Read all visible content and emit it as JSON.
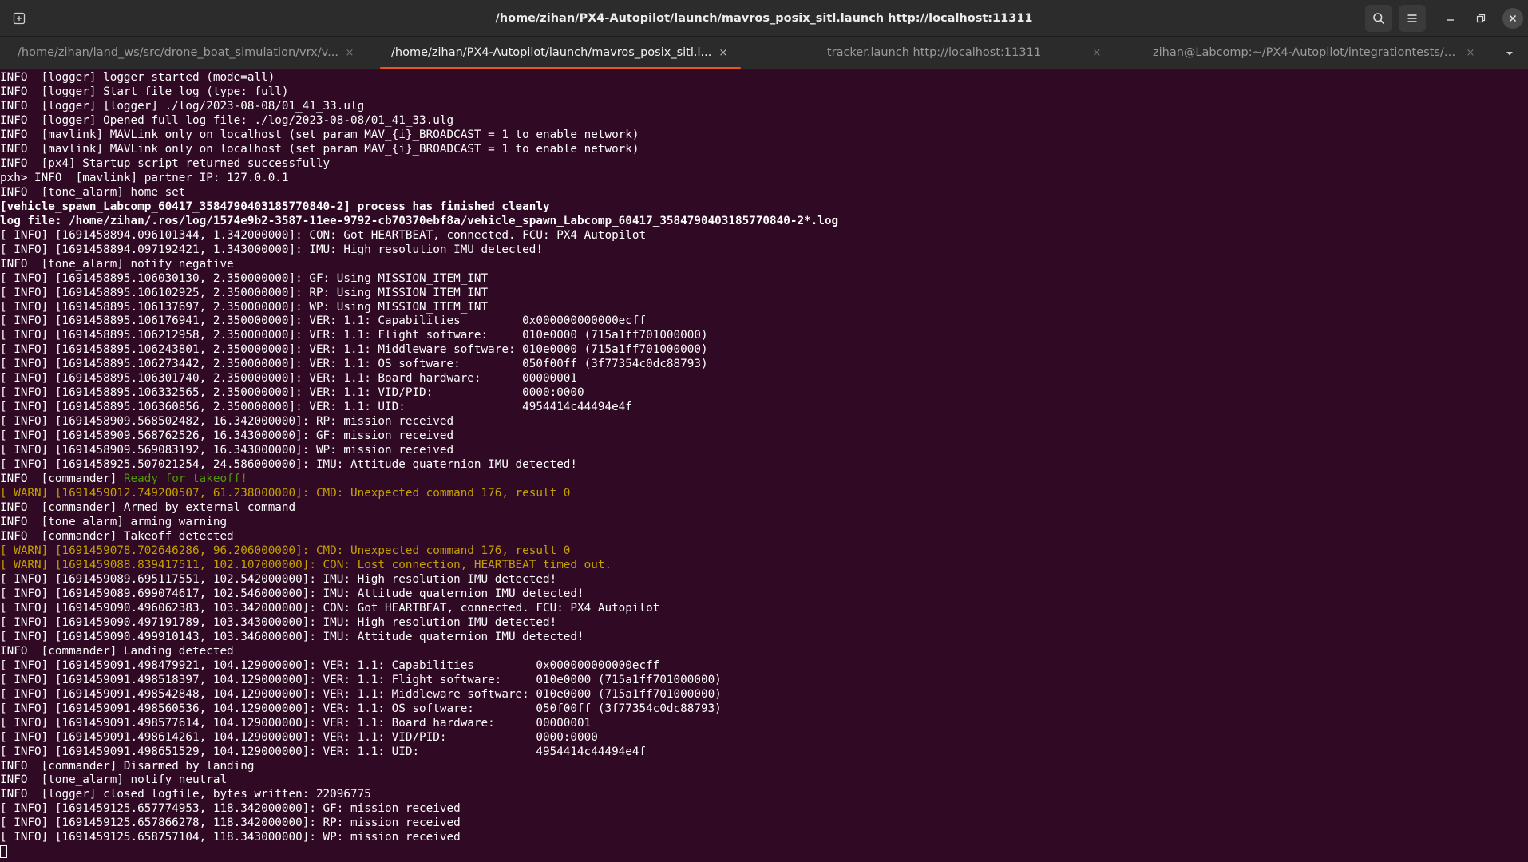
{
  "window": {
    "title": "/home/zihan/PX4-Autopilot/launch/mavros_posix_sitl.launch http://localhost:11311",
    "icons": {
      "new_tab": "new-tab-icon",
      "search": "search-icon",
      "menu": "hamburger-menu-icon",
      "minimize": "minimize-icon",
      "maximize": "maximize-icon",
      "close": "close-icon"
    },
    "accent_color": "#e95420",
    "background_color": "#300a24"
  },
  "tabs": [
    {
      "label": "/home/zihan/land_ws/src/drone_boat_simulation/vrx/v...",
      "active": false
    },
    {
      "label": "/home/zihan/PX4-Autopilot/launch/mavros_posix_sitl.l...",
      "active": true
    },
    {
      "label": "tracker.launch http://localhost:11311",
      "active": false
    },
    {
      "label": "zihan@Labcomp:~/PX4-Autopilot/integrationtests/pyt...",
      "active": false
    }
  ],
  "tab_close_glyph": "×",
  "terminal": {
    "colors": {
      "text": "#ffffff",
      "warn": "#c4a000",
      "ok": "#4e9a06"
    },
    "lines": [
      {
        "text": "INFO  [logger] logger started (mode=all)"
      },
      {
        "text": "INFO  [logger] Start file log (type: full)"
      },
      {
        "text": "INFO  [logger] [logger] ./log/2023-08-08/01_41_33.ulg"
      },
      {
        "text": "INFO  [logger] Opened full log file: ./log/2023-08-08/01_41_33.ulg"
      },
      {
        "text": "INFO  [mavlink] MAVLink only on localhost (set param MAV_{i}_BROADCAST = 1 to enable network)"
      },
      {
        "text": "INFO  [mavlink] MAVLink only on localhost (set param MAV_{i}_BROADCAST = 1 to enable network)"
      },
      {
        "text": "INFO  [px4] Startup script returned successfully"
      },
      {
        "text": "pxh> INFO  [mavlink] partner IP: 127.0.0.1"
      },
      {
        "text": "INFO  [tone_alarm] home set"
      },
      {
        "text": "[vehicle_spawn_Labcomp_60417_3584790403185770840-2] process has finished cleanly",
        "style": "bold"
      },
      {
        "text": "log file: /home/zihan/.ros/log/1574e9b2-3587-11ee-9792-cb70370ebf8a/vehicle_spawn_Labcomp_60417_3584790403185770840-2*.log",
        "style": "bold"
      },
      {
        "text": "[ INFO] [1691458894.096101344, 1.342000000]: CON: Got HEARTBEAT, connected. FCU: PX4 Autopilot"
      },
      {
        "text": "[ INFO] [1691458894.097192421, 1.343000000]: IMU: High resolution IMU detected!"
      },
      {
        "text": "INFO  [tone_alarm] notify negative"
      },
      {
        "text": "[ INFO] [1691458895.106030130, 2.350000000]: GF: Using MISSION_ITEM_INT"
      },
      {
        "text": "[ INFO] [1691458895.106102925, 2.350000000]: RP: Using MISSION_ITEM_INT"
      },
      {
        "text": "[ INFO] [1691458895.106137697, 2.350000000]: WP: Using MISSION_ITEM_INT"
      },
      {
        "text": "[ INFO] [1691458895.106176941, 2.350000000]: VER: 1.1: Capabilities         0x000000000000ecff"
      },
      {
        "text": "[ INFO] [1691458895.106212958, 2.350000000]: VER: 1.1: Flight software:     010e0000 (715a1ff701000000)"
      },
      {
        "text": "[ INFO] [1691458895.106243801, 2.350000000]: VER: 1.1: Middleware software: 010e0000 (715a1ff701000000)"
      },
      {
        "text": "[ INFO] [1691458895.106273442, 2.350000000]: VER: 1.1: OS software:         050f00ff (3f77354c0dc88793)"
      },
      {
        "text": "[ INFO] [1691458895.106301740, 2.350000000]: VER: 1.1: Board hardware:      00000001"
      },
      {
        "text": "[ INFO] [1691458895.106332565, 2.350000000]: VER: 1.1: VID/PID:             0000:0000"
      },
      {
        "text": "[ INFO] [1691458895.106360856, 2.350000000]: VER: 1.1: UID:                 4954414c44494e4f"
      },
      {
        "text": "[ INFO] [1691458909.568502482, 16.342000000]: RP: mission received"
      },
      {
        "text": "[ INFO] [1691458909.568762526, 16.343000000]: GF: mission received"
      },
      {
        "text": "[ INFO] [1691458909.569083192, 16.343000000]: WP: mission received"
      },
      {
        "text": "[ INFO] [1691458925.507021254, 24.586000000]: IMU: Attitude quaternion IMU detected!"
      },
      {
        "text": "INFO  [commander] ",
        "highlight": "Ready for takeoff!"
      },
      {
        "text": "[ WARN] [1691459012.749200507, 61.238000000]: CMD: Unexpected command 176, result 0",
        "style": "warn"
      },
      {
        "text": "INFO  [commander] Armed by external command"
      },
      {
        "text": "INFO  [tone_alarm] arming warning"
      },
      {
        "text": "INFO  [commander] Takeoff detected"
      },
      {
        "text": "[ WARN] [1691459078.702646286, 96.206000000]: CMD: Unexpected command 176, result 0",
        "style": "warn"
      },
      {
        "text": "[ WARN] [1691459088.839417511, 102.107000000]: CON: Lost connection, HEARTBEAT timed out.",
        "style": "warn"
      },
      {
        "text": "[ INFO] [1691459089.695117551, 102.542000000]: IMU: High resolution IMU detected!"
      },
      {
        "text": "[ INFO] [1691459089.699074617, 102.546000000]: IMU: Attitude quaternion IMU detected!"
      },
      {
        "text": "[ INFO] [1691459090.496062383, 103.342000000]: CON: Got HEARTBEAT, connected. FCU: PX4 Autopilot"
      },
      {
        "text": "[ INFO] [1691459090.497191789, 103.343000000]: IMU: High resolution IMU detected!"
      },
      {
        "text": "[ INFO] [1691459090.499910143, 103.346000000]: IMU: Attitude quaternion IMU detected!"
      },
      {
        "text": "INFO  [commander] Landing detected"
      },
      {
        "text": "[ INFO] [1691459091.498479921, 104.129000000]: VER: 1.1: Capabilities         0x000000000000ecff"
      },
      {
        "text": "[ INFO] [1691459091.498518397, 104.129000000]: VER: 1.1: Flight software:     010e0000 (715a1ff701000000)"
      },
      {
        "text": "[ INFO] [1691459091.498542848, 104.129000000]: VER: 1.1: Middleware software: 010e0000 (715a1ff701000000)"
      },
      {
        "text": "[ INFO] [1691459091.498560536, 104.129000000]: VER: 1.1: OS software:         050f00ff (3f77354c0dc88793)"
      },
      {
        "text": "[ INFO] [1691459091.498577614, 104.129000000]: VER: 1.1: Board hardware:      00000001"
      },
      {
        "text": "[ INFO] [1691459091.498614261, 104.129000000]: VER: 1.1: VID/PID:             0000:0000"
      },
      {
        "text": "[ INFO] [1691459091.498651529, 104.129000000]: VER: 1.1: UID:                 4954414c44494e4f"
      },
      {
        "text": "INFO  [commander] Disarmed by landing"
      },
      {
        "text": "INFO  [tone_alarm] notify neutral"
      },
      {
        "text": "INFO  [logger] closed logfile, bytes written: 22096775"
      },
      {
        "text": "[ INFO] [1691459125.657774953, 118.342000000]: GF: mission received"
      },
      {
        "text": "[ INFO] [1691459125.657866278, 118.342000000]: RP: mission received"
      },
      {
        "text": "[ INFO] [1691459125.658757104, 118.343000000]: WP: mission received"
      }
    ]
  }
}
